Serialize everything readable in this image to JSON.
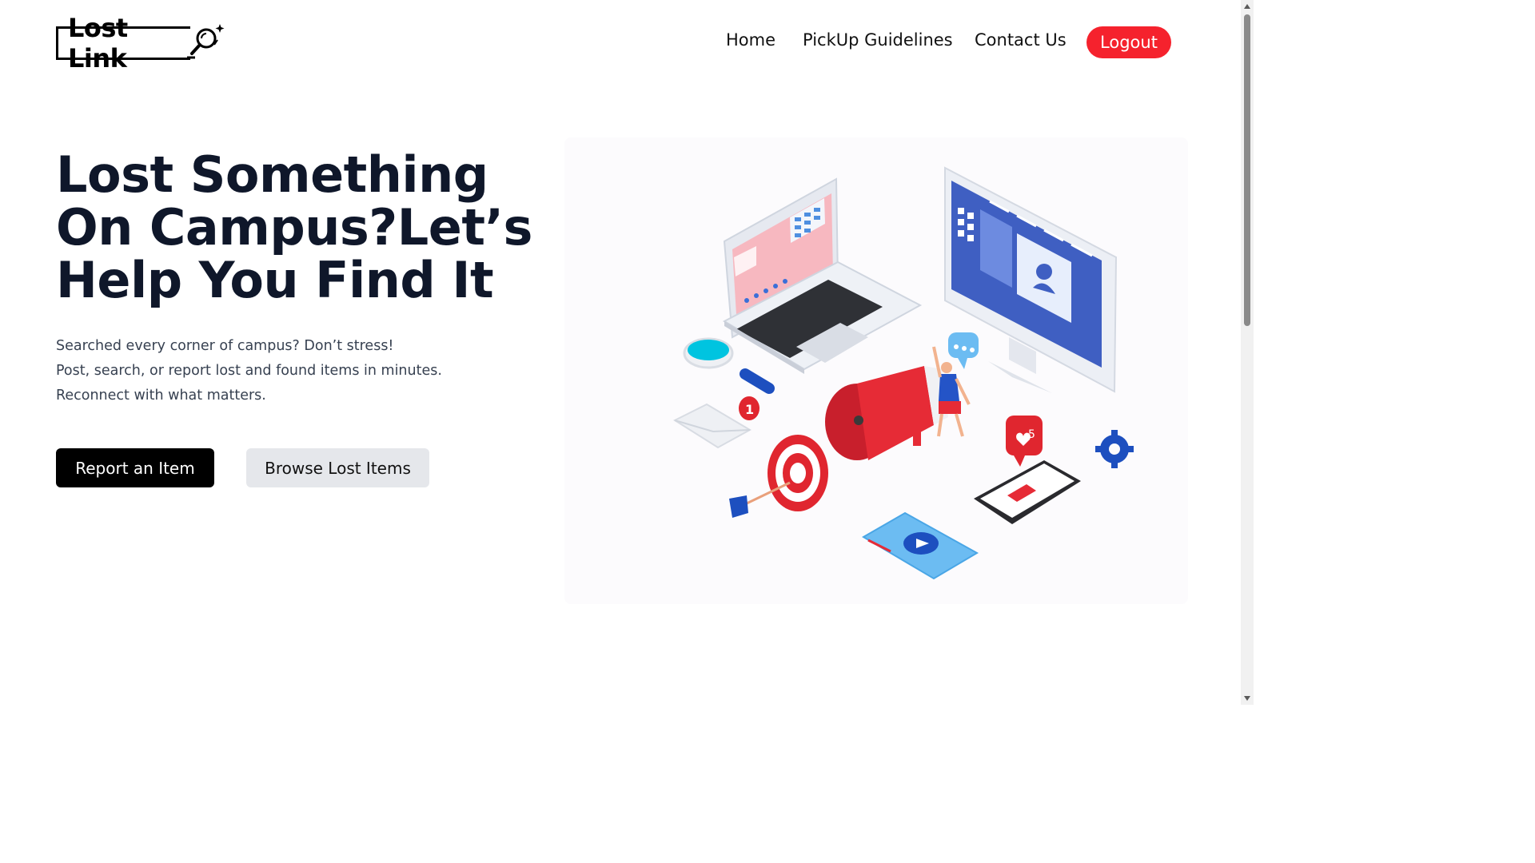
{
  "brand": {
    "name": "Lost Link",
    "icon": "magnifier-sparkle-icon"
  },
  "nav": {
    "items": [
      {
        "label": "Home"
      },
      {
        "label": "PickUp Guidelines"
      },
      {
        "label": "Contact Us"
      }
    ],
    "logout_label": "Logout"
  },
  "hero": {
    "title": "Lost Something On Campus?Let’s Help You Find It",
    "description": [
      "Searched every corner of campus? Don’t stress!",
      "Post, search, or report lost and found items in minutes.",
      "Reconnect with what matters."
    ],
    "primary_button": "Report an Item",
    "secondary_button": "Browse Lost Items",
    "illustration_badges": {
      "notification_count": "1",
      "likes_count": "5"
    }
  },
  "colors": {
    "accent_red": "#f5222d",
    "primary_button_bg": "#000000",
    "secondary_button_bg": "#e5e7eb"
  }
}
